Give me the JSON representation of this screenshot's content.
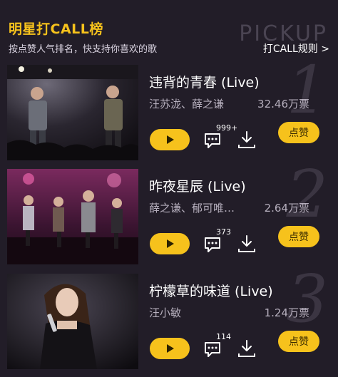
{
  "header": {
    "title": "明星打CALL榜",
    "subtitle": "按点赞人气排名，快支持你喜欢的歌",
    "pickup": "PICKUP",
    "rules_link": "打CALL规则 >"
  },
  "items": [
    {
      "rank": "1",
      "song": "违背的青春 (Live)",
      "artist": "汪苏泷、薛之谦",
      "votes": "32.46万票",
      "comments": "999+",
      "like_label": "点赞"
    },
    {
      "rank": "2",
      "song": "昨夜星辰 (Live)",
      "artist": "薛之谦、郁可唯、...",
      "votes": "2.64万票",
      "comments": "373",
      "like_label": "点赞"
    },
    {
      "rank": "3",
      "song": "柠檬草的味道 (Live)",
      "artist": "汪小敏",
      "votes": "1.24万票",
      "comments": "114",
      "like_label": "点赞"
    }
  ],
  "icons": {
    "play": "play-icon",
    "comment": "comment-icon",
    "download": "download-icon"
  },
  "colors": {
    "background": "#221d28",
    "accent": "#f6c21c",
    "muted_text": "#b6afbd",
    "rank_number": "#3b3542"
  }
}
